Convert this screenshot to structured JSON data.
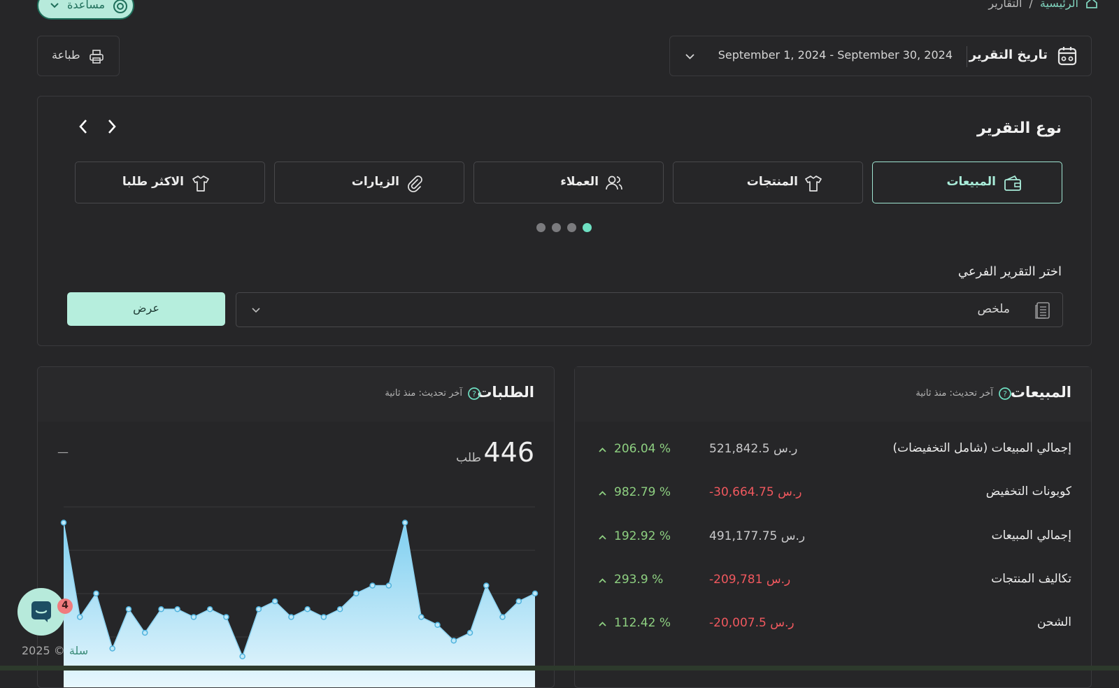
{
  "help": {
    "label": "مساعدة"
  },
  "breadcrumb": {
    "home": "الرئيسية",
    "separator": "/",
    "current": "التقارير"
  },
  "print": {
    "label": "طباعة"
  },
  "date_filter": {
    "label": "تاريخ التقرير",
    "value": "September 1, 2024 - September 30, 2024"
  },
  "report_type": {
    "title": "نوع التقرير",
    "tabs": [
      {
        "label": "المبيعات",
        "icon": "wallet-icon",
        "active": true
      },
      {
        "label": "المنتجات",
        "icon": "tshirt-icon"
      },
      {
        "label": "العملاء",
        "icon": "users-icon"
      },
      {
        "label": "الزيارات",
        "icon": "link-icon"
      },
      {
        "label": "الاكثر طلبا",
        "icon": "tshirt-icon"
      }
    ],
    "page_dots": 4,
    "active_dot": 0
  },
  "sub_report": {
    "label": "اختر التقرير الفرعي",
    "selected": "ملخص",
    "view_button": "عرض"
  },
  "sales_panel": {
    "title": "المبيعات",
    "updated": "آخر تحديث: منذ ثانية",
    "rows": [
      {
        "label": "إجمالي المبيعات (شامل التخفيضات)",
        "value": "521,842.5 ر.س",
        "change": "206.04 %",
        "negative": false
      },
      {
        "label": "كوبونات التخفيض",
        "value": "-30,664.75 ر.س",
        "change": "982.79 %",
        "negative": true
      },
      {
        "label": "إجمالي المبيعات",
        "value": "491,177.75 ر.س",
        "change": "192.92 %",
        "negative": false
      },
      {
        "label": "تكاليف المنتجات",
        "value": "-209,781 ر.س",
        "change": "293.9 %",
        "negative": true
      },
      {
        "label": "الشحن",
        "value": "-20,007.5 ر.س",
        "change": "112.42 %",
        "negative": true
      }
    ]
  },
  "orders_panel": {
    "title": "الطلبات",
    "updated": "آخر تحديث: منذ ثانية",
    "total": "446",
    "unit": "طلب",
    "dash": "—"
  },
  "chart_data": {
    "type": "area",
    "x": [
      1,
      2,
      3,
      4,
      5,
      6,
      7,
      8,
      9,
      10,
      11,
      12,
      13,
      14,
      15,
      16,
      17,
      18,
      19,
      20,
      21,
      22,
      23,
      24,
      25,
      26,
      27,
      28,
      29,
      30
    ],
    "values": [
      22,
      10,
      13,
      6,
      11,
      8,
      11,
      11,
      10,
      11,
      10,
      5,
      11,
      12,
      10,
      11,
      10,
      11,
      13,
      14,
      14,
      22,
      10,
      9,
      7,
      8,
      14,
      10,
      12,
      13
    ],
    "color": "#8fd4f2",
    "grid": true
  },
  "chat": {
    "badge": "4"
  },
  "footer": {
    "year": "2025 ©",
    "brand": "سلة"
  },
  "colors": {
    "accent": "#a9ecd9",
    "negative": "#f0585e",
    "positive": "#8ed081",
    "background": "#262628"
  }
}
